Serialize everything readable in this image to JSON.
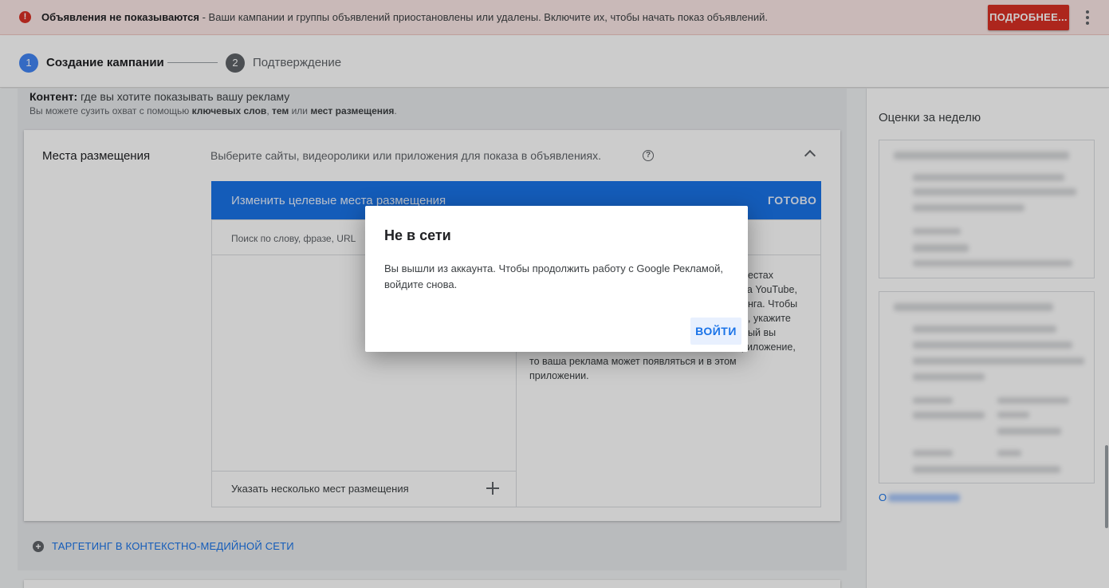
{
  "notification": {
    "icon": "error-icon",
    "title": "Объявления не показываются",
    "message": " - Ваши кампании и группы объявлений приостановлены или удалены. Включите их, чтобы начать показ объявлений.",
    "button_label": "ПОДРОБНЕЕ...",
    "color": "#d93025"
  },
  "stepper": {
    "steps": [
      {
        "number": "1",
        "label": "Создание кампании"
      },
      {
        "number": "2",
        "label": "Подтверждение"
      }
    ]
  },
  "content_section": {
    "title_bold": "Контент:",
    "title_rest": " где вы хотите показывать вашу рекламу",
    "sub_prefix": "Вы можете сузить охват с помощью ",
    "sub_keywords": "ключевых слов",
    "sub_comma": ", ",
    "sub_topics": "тем",
    "sub_or": " или ",
    "sub_placements": "мест размещения",
    "sub_end": "."
  },
  "placements_card": {
    "label": "Места размещения",
    "description": "Выберите сайты, видеоролики или приложения для показа в объявлениях.",
    "help_glyph": "?",
    "editor_title": "Изменить целевые места размещения",
    "done_label": "ГОТОВО",
    "search_placeholder": "Поиск по слову, фразе, URL",
    "multi_label": "Указать несколько мест размещения",
    "help_lines": [
      "естах",
      "на YouTube,",
      "нга. Чтобы",
      ", укажите",
      "ый вы",
      "риложение,",
      "то ваша реклама может появляться и в этом",
      "приложении."
    ]
  },
  "targeting_link": {
    "icon_glyph": "+",
    "label": "ТАРГЕТИНГ В КОНТЕКСТНО-МЕДИЙНОЙ СЕТИ"
  },
  "sidebar": {
    "title": "Оценки за неделю",
    "link_first_letter": "О"
  },
  "dialog": {
    "title": "Не в сети",
    "body": "Вы вышли из аккаунта. Чтобы продолжить работу с Google Рекламой, войдите снова.",
    "button_label": "ВОЙТИ"
  },
  "colors": {
    "accent": "#1a73e8",
    "error": "#d93025",
    "step_active": "#4285f4"
  }
}
